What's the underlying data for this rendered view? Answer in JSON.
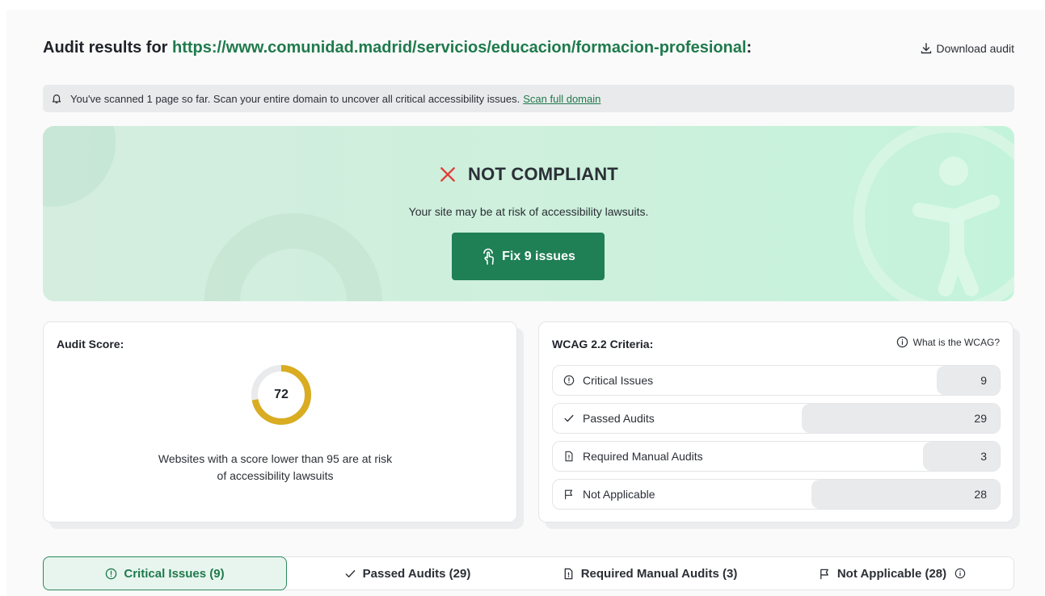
{
  "header": {
    "title_prefix": "Audit results for ",
    "url": "https://www.comunidad.madrid/servicios/educacion/formacion-profesional",
    "title_suffix": ":",
    "download_label": "Download audit"
  },
  "notice": {
    "text": "You've scanned 1 page so far. Scan your entire domain to uncover all critical accessibility issues.",
    "link": "Scan full domain"
  },
  "hero": {
    "status": "NOT COMPLIANT",
    "subtitle": "Your site may be at risk of accessibility lawsuits.",
    "fix_button": "Fix 9 issues"
  },
  "score_card": {
    "title": "Audit Score:",
    "score": "72",
    "score_fraction": 0.72,
    "note_line1": "Websites with a score lower than 95 are at risk",
    "note_line2": "of accessibility lawsuits"
  },
  "wcag_card": {
    "title": "WCAG 2.2 Criteria:",
    "what_link": "What is the WCAG?",
    "rows": [
      {
        "label": "Critical Issues",
        "count": "9"
      },
      {
        "label": "Passed Audits",
        "count": "29"
      },
      {
        "label": "Required Manual Audits",
        "count": "3"
      },
      {
        "label": "Not Applicable",
        "count": "28"
      }
    ]
  },
  "tabs": [
    {
      "label": "Critical Issues (9)"
    },
    {
      "label": "Passed Audits (29)"
    },
    {
      "label": "Required Manual Audits (3)"
    },
    {
      "label": "Not Applicable (28)"
    }
  ],
  "colors": {
    "brand_green": "#1f7f55",
    "fail_red": "#e0403a",
    "score_gold": "#d9ac22"
  }
}
